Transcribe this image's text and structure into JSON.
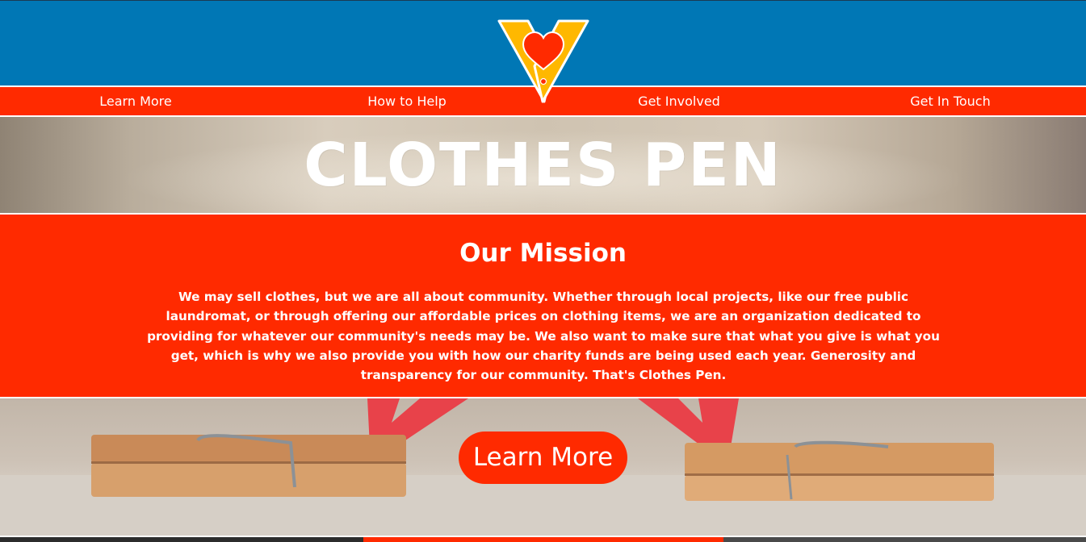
{
  "header": {
    "logo_icon": "clothespin-heart-logo-icon",
    "nav": [
      {
        "label": "Learn More"
      },
      {
        "label": "How to Help"
      },
      {
        "label": "Get Involved"
      },
      {
        "label": "Get In Touch"
      }
    ]
  },
  "hero": {
    "title": "CLOTHES PEN"
  },
  "mission": {
    "title": "Our Mission",
    "text": "We may sell clothes, but we are all about community. Whether through local projects, like our free public laundromat, or through offering our affordable prices on clothing items, we are an organization dedicated to providing for whatever our community's needs may be. We also want to make sure that what you give is what you get, which is why we also provide you with how our charity funds are being used each year. Generosity and transparency for our community. That's Clothes Pen."
  },
  "banner": {
    "button_label": "Learn More"
  },
  "colors": {
    "header_blue": "#0077b5",
    "brand_red": "#ff2a00",
    "logo_yellow": "#ffb800",
    "white": "#ffffff"
  }
}
